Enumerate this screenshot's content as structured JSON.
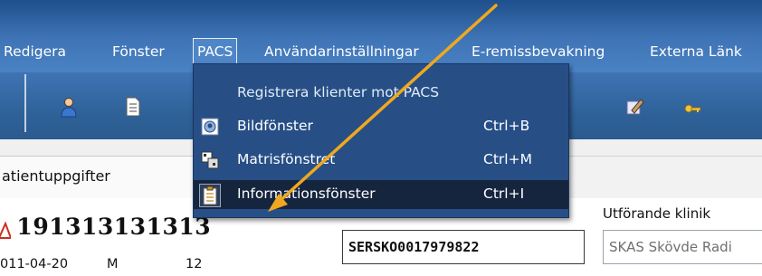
{
  "menu": {
    "items": [
      "Redigera",
      "Fönster",
      "PACS",
      "Användarinställningar",
      "E-remissbevakning",
      "Externa Länk"
    ]
  },
  "toolbar": {
    "icons": [
      "user-icon",
      "document-icon",
      "edit-icon",
      "key-icon"
    ]
  },
  "dropdown": {
    "items": [
      {
        "label": "Registrera klienter mot PACS",
        "shortcut": ""
      },
      {
        "label": "Bildfönster",
        "shortcut": "Ctrl+B"
      },
      {
        "label": "Matrisfönstret",
        "shortcut": "Ctrl+M"
      },
      {
        "label": "Informationsfönster",
        "shortcut": "Ctrl+I"
      }
    ]
  },
  "patient": {
    "tab_label": "atientuppgifter",
    "id": "191313131313",
    "date": "011-04-20",
    "sex": "M",
    "age": "12"
  },
  "referral": {
    "number": "SERSKO0017979822",
    "klinik_label": "Utförande klinik",
    "klinik_value": "SKAS Skövde Radi"
  },
  "colors": {
    "menubar": "#3f75b7",
    "dropdown_bg": "#274f86",
    "selected_bg": "#16253e",
    "arrow": "#f0a81e"
  }
}
